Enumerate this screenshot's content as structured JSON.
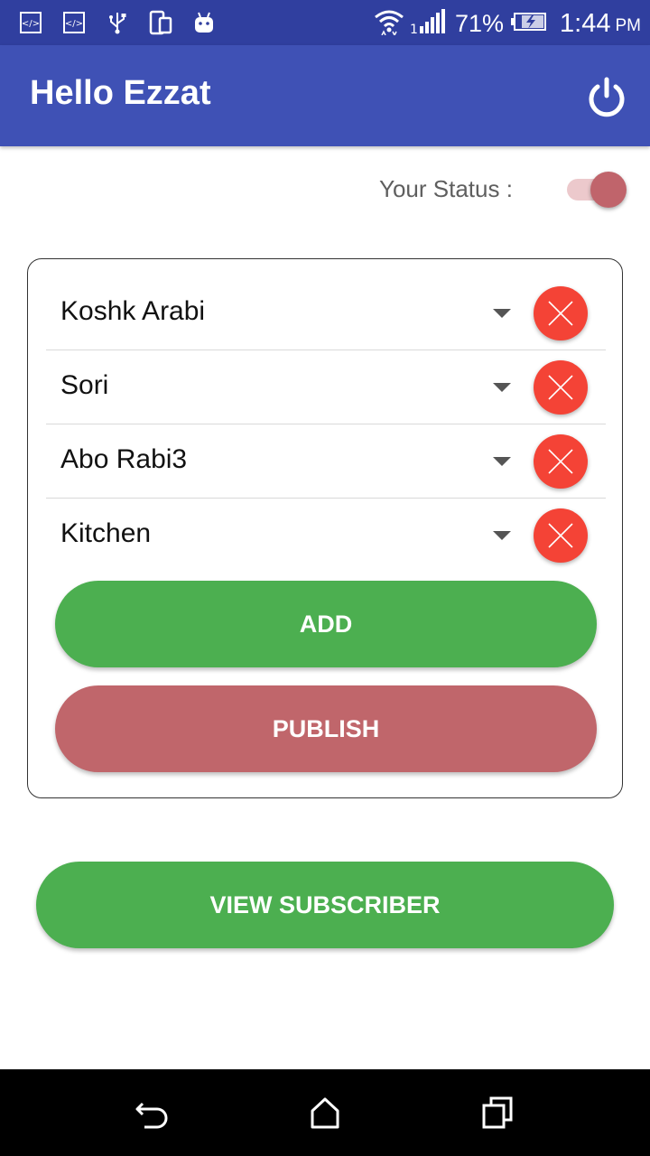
{
  "status_bar": {
    "battery_percent": "71%",
    "time": "1:44",
    "ampm": "PM",
    "icons": [
      "code-icon",
      "code-icon",
      "usb-icon",
      "devices-icon",
      "android-icon",
      "wifi-icon",
      "signal-icon",
      "battery-charging-icon"
    ]
  },
  "app_bar": {
    "title": "Hello Ezzat",
    "power_icon": "power-icon",
    "color": "#3f51b5"
  },
  "status_row": {
    "label": "Your Status :",
    "toggle_on": true
  },
  "items": [
    {
      "label": "Koshk Arabi"
    },
    {
      "label": "Sori"
    },
    {
      "label": "Abo Rabi3"
    },
    {
      "label": "Kitchen"
    }
  ],
  "buttons": {
    "add": "ADD",
    "publish": "PUBLISH",
    "view_subscriber": "VIEW SUBSCRIBER"
  },
  "colors": {
    "green": "#4caf50",
    "publish": "#c0666b",
    "delete": "#f44336"
  },
  "nav_bar": {
    "icons": [
      "back-icon",
      "home-icon",
      "recents-icon"
    ]
  }
}
